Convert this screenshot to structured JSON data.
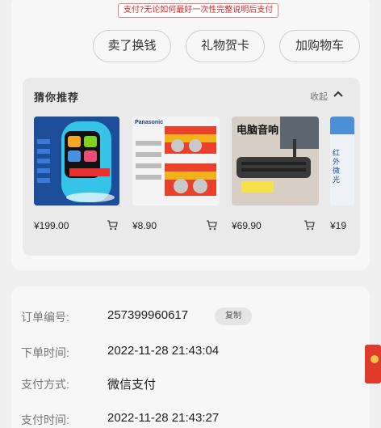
{
  "notice": "支付?无论如何最好一次性完整说明后支付",
  "actions": [
    {
      "label": "卖了换钱"
    },
    {
      "label": "礼物贺卡"
    },
    {
      "label": "加购物车"
    }
  ],
  "recommend": {
    "title": "猜你推荐",
    "collapse_label": "收起",
    "products": [
      {
        "price": "¥199.00",
        "image": "smart-watch-product",
        "image_text": ""
      },
      {
        "price": "¥8.90",
        "image": "panasonic-battery-product",
        "image_text": "Panasonic"
      },
      {
        "price": "¥69.90",
        "image": "computer-speaker-product",
        "image_text": "电脑音响"
      },
      {
        "price": "¥19",
        "image": "partial-product",
        "image_text": "红外微光"
      }
    ]
  },
  "order_info": {
    "order_number_label": "订单编号:",
    "order_number": "257399960617",
    "copy_label": "复制",
    "order_time_label": "下单时间:",
    "order_time": "2022-11-28 21:43:04",
    "payment_method_label": "支付方式:",
    "payment_method": "微信支付",
    "payment_time_label": "支付时间:",
    "payment_time": "2022-11-28 21:43:27"
  },
  "colors": {
    "notice_red": "#cc2b2b",
    "card_bg": "#f7f7f7",
    "page_bg": "#efefef"
  }
}
